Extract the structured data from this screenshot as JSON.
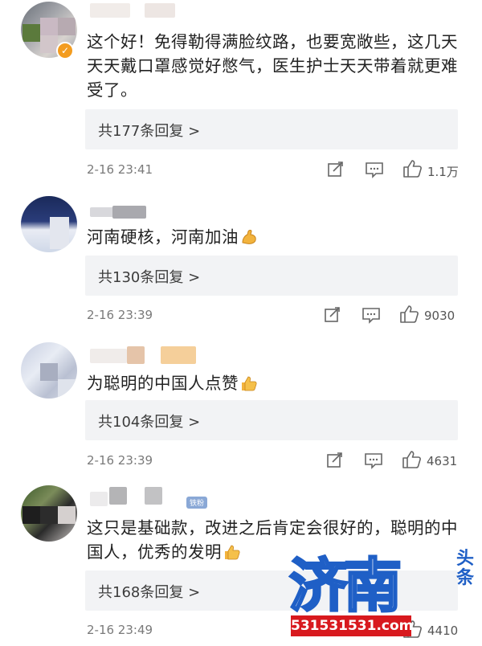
{
  "comments": [
    {
      "text": "这个好！免得勒得满脸纹路，也要宽敞些，这几天天天戴口罩感觉好憋气，医生护士天天带着就更难受了。",
      "emoji": "",
      "replies": "共177条回复 >",
      "time": "2-16 23:41",
      "likes": "1.1万",
      "verified": true
    },
    {
      "text": "河南硬核，河南加油",
      "emoji": "flexed-biceps-icon",
      "replies": "共130条回复 >",
      "time": "2-16 23:39",
      "likes": "9030"
    },
    {
      "text": "为聪明的中国人点赞",
      "emoji": "thumbs-up-icon",
      "replies": "共104条回复 >",
      "time": "2-16 23:39",
      "likes": "4631"
    },
    {
      "text": "这只是基础款，改进之后肯定会很好的，聪明的中国人，优秀的发明",
      "emoji": "thumbs-up-icon",
      "replies": "共168条回复 >",
      "time": "2-16 23:49",
      "likes": "4410",
      "tag": "铁粉"
    }
  ],
  "watermark": {
    "main": "济南",
    "side": "头条",
    "url": "531531531.com"
  },
  "colors": {
    "reply_bg": "#f2f3f5",
    "watermark_blue": "#1f5fc6",
    "watermark_red": "#d8191e"
  }
}
